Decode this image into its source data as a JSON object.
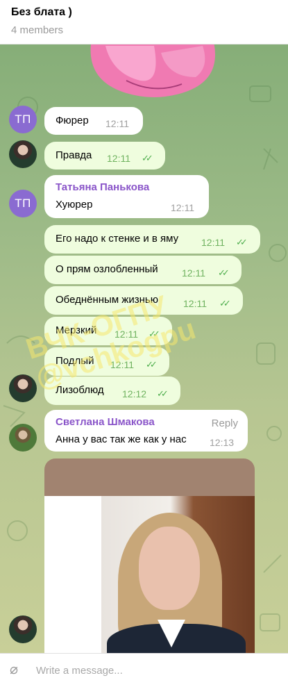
{
  "header": {
    "title": "Без блата )",
    "members": "4 members"
  },
  "avatars": {
    "tatiana": "ТП"
  },
  "messages": [
    {
      "text": "Фюрер",
      "time": "12:11"
    },
    {
      "text": "Правда",
      "time": "12:11"
    },
    {
      "sender": "Татьяна Панькова",
      "text": "Хуюрер",
      "time": "12:11"
    },
    {
      "text": "Его надо к стенке и в яму",
      "time": "12:11"
    },
    {
      "text": "О прям озлобленный",
      "time": "12:11"
    },
    {
      "text": "Обеднённым жизнью",
      "time": "12:11"
    },
    {
      "text": "Мерзкий",
      "time": "12:11"
    },
    {
      "text": "Подлый",
      "time": "12:11"
    },
    {
      "text": "Лизоблюд",
      "time": "12:12"
    },
    {
      "sender": "Светлана Шмакова",
      "reply": "Reply",
      "text": "Анна у вас так же как у нас",
      "time": "12:13"
    }
  ],
  "watermark": {
    "line1": "ВЧК-ОГПУ",
    "line2": "@vchkogpu"
  },
  "composer": {
    "placeholder": "Write a message..."
  },
  "colors": {
    "sender_name": "#8a55c9",
    "outgoing_bubble": "#effdde",
    "check": "#4fae4e"
  },
  "icons": {
    "read_receipt": "double-check-icon",
    "attach": "paperclip-icon"
  }
}
